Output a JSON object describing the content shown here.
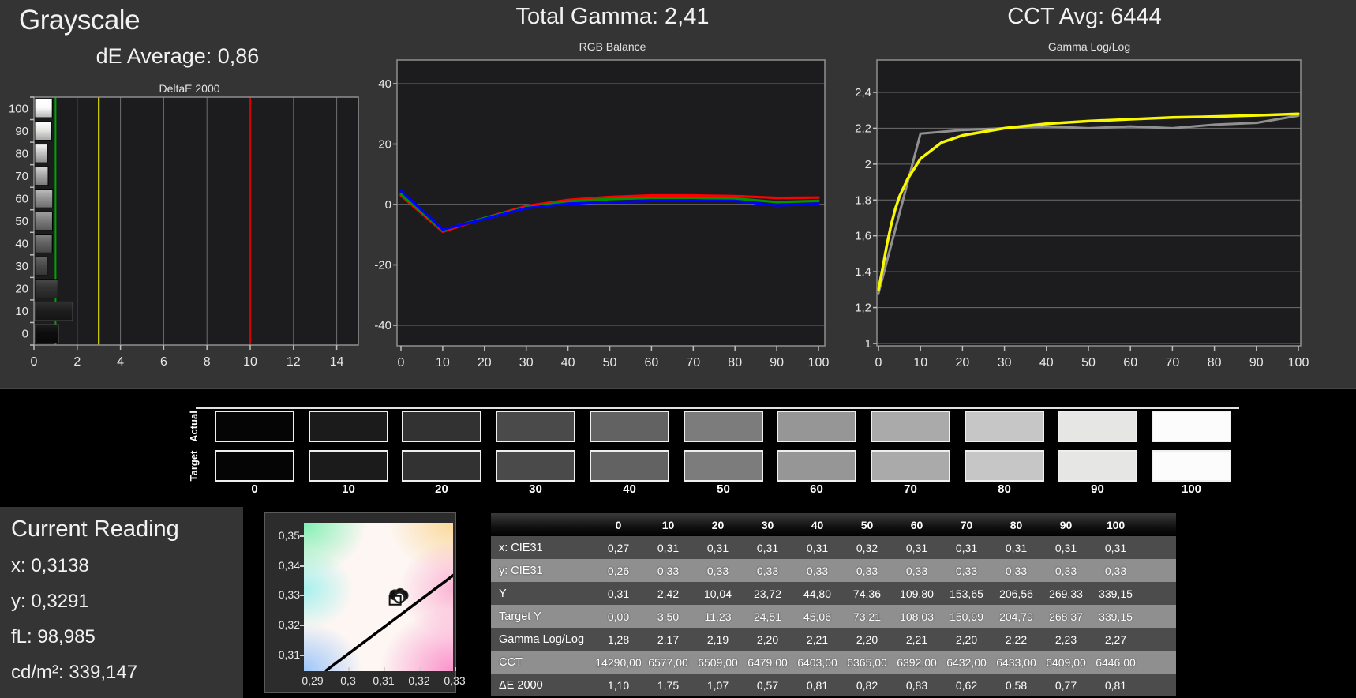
{
  "header": {
    "title": "Grayscale",
    "de_average": "dE Average: 0,86",
    "total_gamma": "Total Gamma: 2,41",
    "cct_avg": "CCT Avg: 6444"
  },
  "current_reading": {
    "title": "Current Reading",
    "x": "x: 0,3138",
    "y": "y: 0,3291",
    "fl": "fL: 98,985",
    "cdm2": "cd/m²: 339,147"
  },
  "swatch_strip": {
    "row_labels": [
      "Actual",
      "Target"
    ],
    "levels": [
      "0",
      "10",
      "20",
      "30",
      "40",
      "50",
      "60",
      "70",
      "80",
      "90",
      "100"
    ],
    "colors": [
      "#050505",
      "#1b1b1b",
      "#323232",
      "#4a4a4a",
      "#626262",
      "#7c7c7c",
      "#969696",
      "#aaaaaa",
      "#c6c6c6",
      "#e6e6e4",
      "#fdfcfc"
    ]
  },
  "table": {
    "columns": [
      "0",
      "10",
      "20",
      "30",
      "40",
      "50",
      "60",
      "70",
      "80",
      "90",
      "100"
    ],
    "rows": [
      {
        "label": "x: CIE31",
        "values": [
          "0,27",
          "0,31",
          "0,31",
          "0,31",
          "0,31",
          "0,32",
          "0,31",
          "0,31",
          "0,31",
          "0,31",
          "0,31"
        ]
      },
      {
        "label": "y: CIE31",
        "values": [
          "0,26",
          "0,33",
          "0,33",
          "0,33",
          "0,33",
          "0,33",
          "0,33",
          "0,33",
          "0,33",
          "0,33",
          "0,33"
        ]
      },
      {
        "label": "Y",
        "values": [
          "0,31",
          "2,42",
          "10,04",
          "23,72",
          "44,80",
          "74,36",
          "109,80",
          "153,65",
          "206,56",
          "269,33",
          "339,15"
        ]
      },
      {
        "label": "Target Y",
        "values": [
          "0,00",
          "3,50",
          "11,23",
          "24,51",
          "45,06",
          "73,21",
          "108,03",
          "150,99",
          "204,79",
          "268,37",
          "339,15"
        ]
      },
      {
        "label": "Gamma Log/Log",
        "values": [
          "1,28",
          "2,17",
          "2,19",
          "2,20",
          "2,21",
          "2,20",
          "2,21",
          "2,20",
          "2,22",
          "2,23",
          "2,27"
        ]
      },
      {
        "label": "CCT",
        "values": [
          "14290,00",
          "6577,00",
          "6509,00",
          "6479,00",
          "6403,00",
          "6365,00",
          "6392,00",
          "6432,00",
          "6433,00",
          "6409,00",
          "6446,00"
        ]
      },
      {
        "label": "ΔE 2000",
        "values": [
          "1,10",
          "1,75",
          "1,07",
          "0,57",
          "0,81",
          "0,82",
          "0,83",
          "0,62",
          "0,58",
          "0,77",
          "0,81"
        ]
      }
    ]
  },
  "chart_data": [
    {
      "type": "bar",
      "orientation": "horizontal",
      "title": "DeltaE 2000",
      "categories": [
        0,
        10,
        20,
        30,
        40,
        50,
        60,
        70,
        80,
        90,
        100
      ],
      "values": [
        1.1,
        1.75,
        1.07,
        0.57,
        0.81,
        0.82,
        0.83,
        0.62,
        0.58,
        0.77,
        0.81
      ],
      "bar_colors": [
        "#0d0d0d",
        "#1d1d1d",
        "#323232",
        "#4a4a4a",
        "#626262",
        "#7c7c7c",
        "#969696",
        "#aaaaaa",
        "#c6c6c6",
        "#e6e6e4",
        "#fdfcfc"
      ],
      "xlim": [
        0,
        15
      ],
      "x_tick_values": [
        0,
        2,
        4,
        6,
        8,
        10,
        12,
        14
      ],
      "x_tick_labels": [
        "0",
        "2",
        "4",
        "6",
        "8",
        "10",
        "12",
        "14"
      ],
      "y_tick_labels": [
        "100",
        "90",
        "80",
        "70",
        "60",
        "50",
        "40",
        "30",
        "20",
        "10",
        "0"
      ],
      "reference_lines": [
        {
          "value": 1,
          "color": "#00a400",
          "name": "green-threshold"
        },
        {
          "value": 3,
          "color": "#f2f200",
          "name": "yellow-threshold"
        },
        {
          "value": 10,
          "color": "#d40000",
          "name": "red-threshold"
        }
      ]
    },
    {
      "type": "line",
      "title": "RGB Balance",
      "x": [
        0,
        10,
        20,
        30,
        40,
        50,
        60,
        70,
        80,
        90,
        100
      ],
      "x_tick_labels": [
        "0",
        "10",
        "20",
        "30",
        "40",
        "50",
        "60",
        "70",
        "80",
        "90",
        "100"
      ],
      "ylim": [
        -46.5,
        47.5
      ],
      "y_ticks": [
        {
          "v": 40,
          "label": "40"
        },
        {
          "v": 20,
          "label": "20"
        },
        {
          "v": 0,
          "label": "0"
        },
        {
          "v": -20,
          "label": "-20"
        },
        {
          "v": -40,
          "label": "-40"
        }
      ],
      "series": [
        {
          "name": "Red",
          "color": "#ff0000",
          "values": [
            3.0,
            -9.0,
            -4.5,
            -0.5,
            1.5,
            2.5,
            3.0,
            3.0,
            2.8,
            2.2,
            2.3
          ]
        },
        {
          "name": "Green",
          "color": "#009600",
          "values": [
            3.5,
            -8.5,
            -4.5,
            -1.0,
            1.0,
            1.8,
            2.2,
            2.2,
            2.0,
            0.8,
            1.2
          ]
        },
        {
          "name": "Blue",
          "color": "#0000ff",
          "values": [
            4.5,
            -8.3,
            -4.8,
            -1.2,
            0.3,
            0.8,
            1.2,
            1.3,
            1.2,
            -0.3,
            0.3
          ]
        }
      ]
    },
    {
      "type": "line",
      "title": "Gamma Log/Log",
      "x_tick_values": [
        0,
        10,
        20,
        30,
        40,
        50,
        60,
        70,
        80,
        90,
        100
      ],
      "x_tick_labels": [
        "0",
        "10",
        "20",
        "30",
        "40",
        "50",
        "60",
        "70",
        "80",
        "90",
        "100"
      ],
      "ylim": [
        0.99,
        2.58
      ],
      "y_ticks": [
        {
          "v": 1,
          "label": "1"
        },
        {
          "v": 1.2,
          "label": "1,2"
        },
        {
          "v": 1.4,
          "label": "1,4"
        },
        {
          "v": 1.6,
          "label": "1,6"
        },
        {
          "v": 1.8,
          "label": "1,8"
        },
        {
          "v": 2,
          "label": "2"
        },
        {
          "v": 2.2,
          "label": "2,2"
        },
        {
          "v": 2.4,
          "label": "2,4"
        }
      ],
      "series": [
        {
          "name": "Target gamma",
          "color": "#f8f800",
          "width": 3.5,
          "x": [
            0,
            1,
            2,
            3,
            4,
            5,
            7,
            10,
            15,
            20,
            30,
            40,
            50,
            60,
            70,
            80,
            90,
            100
          ],
          "values": [
            1.3,
            1.42,
            1.55,
            1.66,
            1.75,
            1.82,
            1.92,
            2.03,
            2.12,
            2.16,
            2.2,
            2.225,
            2.24,
            2.25,
            2.26,
            2.265,
            2.272,
            2.28
          ]
        },
        {
          "name": "Measured gamma",
          "color": "#909090",
          "width": 3,
          "x": [
            0,
            10,
            20,
            30,
            40,
            50,
            60,
            70,
            80,
            90,
            100
          ],
          "values": [
            1.28,
            2.17,
            2.19,
            2.2,
            2.21,
            2.2,
            2.21,
            2.2,
            2.22,
            2.23,
            2.27
          ]
        }
      ]
    },
    {
      "type": "scatter",
      "title": "CIE chromaticity",
      "x_range": [
        0.2876,
        0.3296
      ],
      "y_range": [
        0.3043,
        0.3543
      ],
      "x_ticks": {
        "values": [
          0.29,
          0.3,
          0.31,
          0.32,
          0.33
        ],
        "labels": [
          "0,29",
          "0,3",
          "0,31",
          "0,32",
          "0,33"
        ]
      },
      "y_ticks": {
        "values": [
          0.35,
          0.34,
          0.33,
          0.32,
          0.31
        ],
        "labels": [
          "0,35",
          "0,34",
          "0,33",
          "0,32",
          "0,31"
        ]
      },
      "locus_line": [
        [
          0.2936,
          0.3043
        ],
        [
          0.331,
          0.3378
        ]
      ],
      "points": [
        {
          "x": 0.3132,
          "y": 0.33,
          "style": "black"
        },
        {
          "x": 0.3147,
          "y": 0.3304,
          "style": "black"
        },
        {
          "x": 0.3155,
          "y": 0.3298,
          "style": "black"
        },
        {
          "x": 0.3145,
          "y": 0.3291,
          "style": "white"
        },
        {
          "x": 0.3133,
          "y": 0.3283,
          "style": "square"
        }
      ]
    }
  ]
}
